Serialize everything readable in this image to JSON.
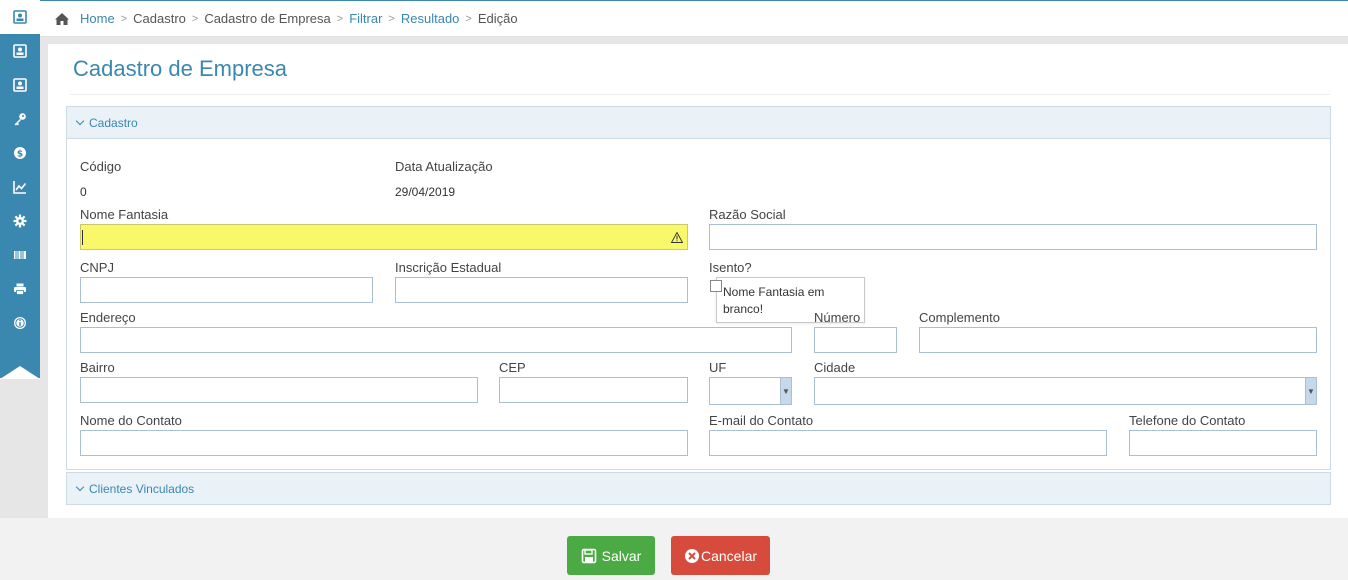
{
  "sidebar": {
    "items": [
      {
        "icon": "contact-card-icon"
      },
      {
        "icon": "contact-card-icon"
      },
      {
        "icon": "contact-card-icon"
      },
      {
        "icon": "key-icon"
      },
      {
        "icon": "dollar-icon"
      },
      {
        "icon": "chart-icon"
      },
      {
        "icon": "gear-icon"
      },
      {
        "icon": "barcode-icon"
      },
      {
        "icon": "printer-icon"
      },
      {
        "icon": "info-icon"
      }
    ]
  },
  "breadcrumb": {
    "home": "Home",
    "cadastro": "Cadastro",
    "cadastro_empresa": "Cadastro de Empresa",
    "filtrar": "Filtrar",
    "resultado": "Resultado",
    "edicao": "Edição"
  },
  "page": {
    "title": "Cadastro de Empresa"
  },
  "section_cadastro": {
    "title": "Cadastro",
    "codigo_label": "Código",
    "codigo_value": "0",
    "data_atualizacao_label": "Data Atualização",
    "data_atualizacao_value": "29/04/2019",
    "nome_fantasia_label": "Nome Fantasia",
    "nome_fantasia_value": "",
    "razao_social_label": "Razão Social",
    "razao_social_value": "",
    "tooltip": "Nome Fantasia em branco!",
    "cnpj_label": "CNPJ",
    "inscricao_estadual_label": "Inscrição Estadual",
    "isento_label": "Isento?",
    "endereco_label": "Endereço",
    "numero_label": "Número",
    "complemento_label": "Complemento",
    "bairro_label": "Bairro",
    "cep_label": "CEP",
    "uf_label": "UF",
    "cidade_label": "Cidade",
    "nome_contato_label": "Nome do Contato",
    "email_contato_label": "E-mail do Contato",
    "telefone_contato_label": "Telefone do Contato"
  },
  "section_clientes": {
    "title": "Clientes Vinculados"
  },
  "footer": {
    "save_label": "Salvar",
    "cancel_label": "Cancelar"
  },
  "colors": {
    "accent": "#3a87b0",
    "alert_field": "#f8f86a",
    "save": "#4caa44",
    "cancel": "#d64b3b"
  }
}
